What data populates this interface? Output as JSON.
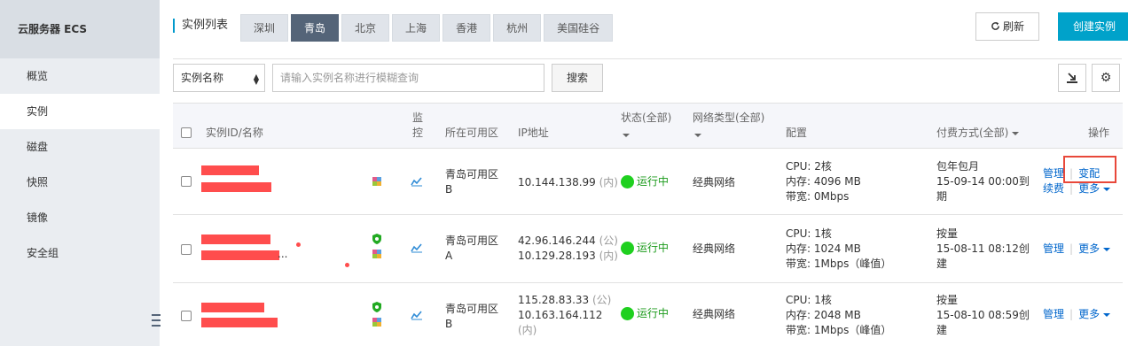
{
  "sidebar": {
    "title": "云服务器 ECS",
    "items": [
      {
        "label": "概览"
      },
      {
        "label": "实例"
      },
      {
        "label": "磁盘"
      },
      {
        "label": "快照"
      },
      {
        "label": "镜像"
      },
      {
        "label": "安全组"
      }
    ]
  },
  "header": {
    "title": "实例列表",
    "regions": [
      "深圳",
      "青岛",
      "北京",
      "上海",
      "香港",
      "杭州",
      "美国硅谷"
    ],
    "active_region": "青岛",
    "refresh_label": "刷新",
    "create_label": "创建实例"
  },
  "search": {
    "select_value": "实例名称",
    "placeholder": "请输入实例名称进行模糊查询",
    "button_label": "搜索"
  },
  "table": {
    "headers": {
      "id_name": "实例ID/名称",
      "monitor_line1": "监",
      "monitor_line2": "控",
      "zone": "所在可用区",
      "ip": "IP地址",
      "status": "状态(全部)",
      "network": "网络类型(全部)",
      "config": "配置",
      "billing": "付费方式(全部)",
      "actions": "操作"
    },
    "rows": [
      {
        "zone_line1": "青岛可用区",
        "zone_line2": "B",
        "ip_line1": "10.144.138.99",
        "ip_line1_tag": "(内)",
        "ip_line2": "",
        "ip_line2_tag": "",
        "status": "运行中",
        "network": "经典网络",
        "cpu": "CPU:   2核",
        "mem": "内存:   4096 MB",
        "bw": "带宽:   0Mbps",
        "billing_line1": "包年包月",
        "billing_line2": "15-09-14 00:00到",
        "billing_line3": "期",
        "action_manage": "管理",
        "action_change": "变配",
        "action_renew": "续费",
        "action_more": "更多"
      },
      {
        "name_suffix": "...",
        "zone_line1": "青岛可用区",
        "zone_line2": "A",
        "ip_line1": "42.96.146.244",
        "ip_line1_tag": "(公)",
        "ip_line2": "10.129.28.193",
        "ip_line2_tag": "(内)",
        "status": "运行中",
        "network": "经典网络",
        "cpu": "CPU:   1核",
        "mem": "内存:   1024 MB",
        "bw": "带宽:   1Mbps（峰值）",
        "billing_line1": "按量",
        "billing_line2": "15-08-11 08:12创",
        "billing_line3": "建",
        "action_manage": "管理",
        "action_more": "更多"
      },
      {
        "zone_line1": "青岛可用区",
        "zone_line2": "B",
        "ip_line1": "115.28.83.33",
        "ip_line1_tag": "(公)",
        "ip_line2": "10.163.164.112",
        "ip_line3": "(内)",
        "status": "运行中",
        "network": "经典网络",
        "cpu": "CPU:   1核",
        "mem": "内存:   2048 MB",
        "bw": "带宽:   1Mbps（峰值）",
        "billing_line1": "按量",
        "billing_line2": "15-08-10 08:59创",
        "billing_line3": "建",
        "action_manage": "管理",
        "action_more": "更多"
      }
    ]
  },
  "colors": {
    "accent": "#00a2ca",
    "active_tab": "#546478",
    "link": "#0066cc",
    "status_running": "#1fd01f",
    "highlight": "#e8483a",
    "redaction": "#ff4d4d"
  },
  "icons": {
    "refresh": "refresh-icon",
    "export": "export-icon",
    "settings": "gear-icon",
    "monitor": "chart-line-icon",
    "security": "shield-icon",
    "plugin": "puzzle-icon"
  }
}
